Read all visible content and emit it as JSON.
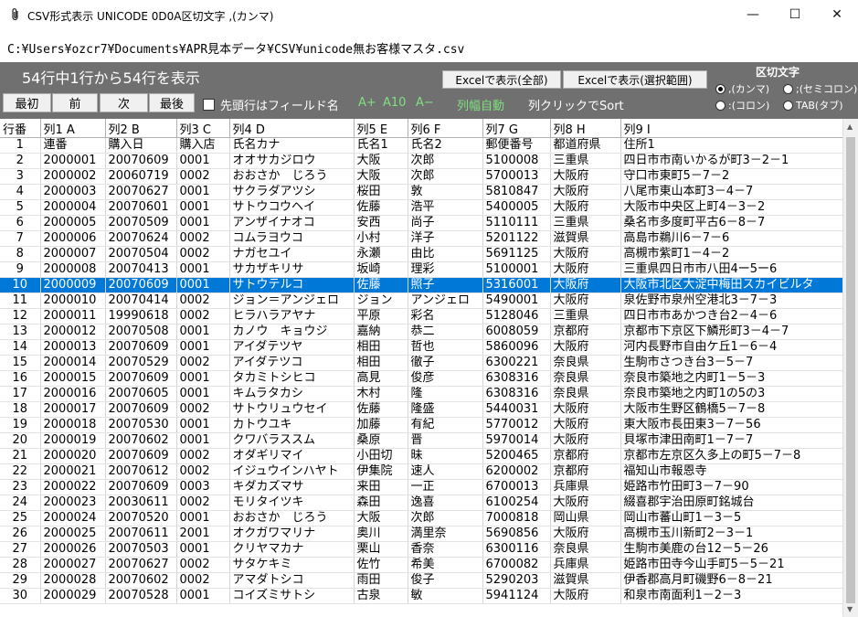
{
  "window": {
    "title": "CSV形式表示 UNICODE 0D0A区切文字 ,(カンマ)",
    "minimize": "—",
    "maximize": "☐",
    "close": "✕"
  },
  "path": "C:¥Users¥ozcr7¥Documents¥APR見本データ¥CSV¥unicode無お客様マスタ.csv",
  "toolbar": {
    "status": "54行中1行から54行を表示",
    "first": "最初",
    "prev": "前",
    "next": "次",
    "last": "最後",
    "header_checkbox_label": "先頭行はフィールド名",
    "font_up": "A+",
    "font_size": "A10",
    "font_down": "A−",
    "auto_width": "列幅自動",
    "sort_hint": "列クリックでSort",
    "excel_all": "Excelで表示(全部)",
    "excel_selected": "Excelで表示(選択範囲)"
  },
  "delimiter": {
    "title": "区切文字",
    "comma": ",(カンマ)",
    "semicolon": ";(セミコロン)",
    "colon": ":(コロン)",
    "tab": "TAB(タブ)",
    "selected": "comma"
  },
  "colors": {
    "toolbar_bg": "#707070",
    "selection": "#0078d7",
    "link_green": "#7fe07f"
  },
  "grid": {
    "columns": [
      "行番",
      "列1 A",
      "列2 B",
      "列3 C",
      "列4 D",
      "列5 E",
      "列6 F",
      "列7 G",
      "列8 H",
      "列9 I"
    ],
    "selected_row": 10,
    "rows": [
      [
        "1",
        "連番",
        "購入日",
        "購入店",
        "氏名カナ",
        "氏名1",
        "氏名2",
        "郵便番号",
        "都道府県",
        "住所1"
      ],
      [
        "2",
        "2000001",
        "20070609",
        "0001",
        "オオサカジロウ",
        "大阪",
        "次郎",
        "5100008",
        "三重県",
        "四日市市南いかるが町3－2－1"
      ],
      [
        "3",
        "2000002",
        "20060719",
        "0002",
        "おおさか　じろう",
        "大阪",
        "次郎",
        "5700013",
        "大阪府",
        "守口市東町5－7－2"
      ],
      [
        "4",
        "2000003",
        "20070627",
        "0001",
        "サクラダアツシ",
        "桜田",
        "敦",
        "5810847",
        "大阪府",
        "八尾市東山本町3－4－7"
      ],
      [
        "5",
        "2000004",
        "20070601",
        "0001",
        "サトウコウヘイ",
        "佐藤",
        "浩平",
        "5400005",
        "大阪府",
        "大阪市中央区上町4－3－2"
      ],
      [
        "6",
        "2000005",
        "20070509",
        "0001",
        "アンザイナオコ",
        "安西",
        "尚子",
        "5110111",
        "三重県",
        "桑名市多度町平古6－8－7"
      ],
      [
        "7",
        "2000006",
        "20070624",
        "0002",
        "コムラヨウコ",
        "小村",
        "洋子",
        "5201122",
        "滋賀県",
        "高島市鵜川6－7－6"
      ],
      [
        "8",
        "2000007",
        "20070504",
        "0002",
        "ナガセユイ",
        "永瀬",
        "由比",
        "5691125",
        "大阪府",
        "高槻市紫町1－4－2"
      ],
      [
        "9",
        "2000008",
        "20070413",
        "0001",
        "サカザキリサ",
        "坂崎",
        "理彩",
        "5100001",
        "大阪府",
        "三重県四日市市八田4ー5ー6"
      ],
      [
        "10",
        "2000009",
        "20070609",
        "0001",
        "サトウテルコ",
        "佐藤",
        "照子",
        "5316001",
        "大阪府",
        "大阪市北区大淀中梅田スカイビルタ"
      ],
      [
        "11",
        "2000010",
        "20070414",
        "0002",
        "ジョン＝アンジェロ",
        "ジョン",
        "アンジェロ",
        "5490001",
        "大阪府",
        "泉佐野市泉州空港北3－7－3"
      ],
      [
        "12",
        "2000011",
        "19990618",
        "0002",
        "ヒラハラアヤナ",
        "平原",
        "彩名",
        "5128046",
        "三重県",
        "四日市市あかつき台2－4－6"
      ],
      [
        "13",
        "2000012",
        "20070508",
        "0001",
        "カノウ　キョウジ",
        "嘉納",
        "恭二",
        "6008059",
        "京都府",
        "京都市下京区下鱗形町3－4－7"
      ],
      [
        "14",
        "2000013",
        "20070609",
        "0001",
        "アイダテツヤ",
        "相田",
        "哲也",
        "5860096",
        "大阪府",
        "河内長野市自由ケ丘1－6－4"
      ],
      [
        "15",
        "2000014",
        "20070529",
        "0002",
        "アイダテツコ",
        "相田",
        "徹子",
        "6300221",
        "奈良県",
        "生駒市さつき台3－5－7"
      ],
      [
        "16",
        "2000015",
        "20070609",
        "0001",
        "タカミトシヒコ",
        "高見",
        "俊彦",
        "6308316",
        "奈良県",
        "奈良市築地之内町1－5－3"
      ],
      [
        "17",
        "2000016",
        "20070605",
        "0001",
        "キムラタカシ",
        "木村",
        "隆",
        "6308316",
        "奈良県",
        "奈良市築地之内町1の5の3"
      ],
      [
        "18",
        "2000017",
        "20070609",
        "0002",
        "サトウリュウセイ",
        "佐藤",
        "隆盛",
        "5440031",
        "大阪府",
        "大阪市生野区鶴橋5－7－8"
      ],
      [
        "19",
        "2000018",
        "20070530",
        "0001",
        "カトウユキ",
        "加藤",
        "有紀",
        "5770012",
        "大阪府",
        "東大阪市長田東3－7－56"
      ],
      [
        "20",
        "2000019",
        "20070602",
        "0001",
        "クワバラススム",
        "桑原",
        "晋",
        "5970014",
        "大阪府",
        "貝塚市津田南町1－7－7"
      ],
      [
        "21",
        "2000020",
        "20070609",
        "0002",
        "オダギリマイ",
        "小田切",
        "昧",
        "5200465",
        "京都府",
        "京都市左京区久多上の町5－7－8"
      ],
      [
        "22",
        "2000021",
        "20070612",
        "0002",
        "イジュウインハヤト",
        "伊集院",
        "速人",
        "6200002",
        "京都府",
        "福知山市報恩寺"
      ],
      [
        "23",
        "2000022",
        "20070609",
        "0003",
        "キダカズマサ",
        "来田",
        "一正",
        "6700013",
        "兵庫県",
        "姫路市竹田町3－7－90"
      ],
      [
        "24",
        "2000023",
        "20030611",
        "0002",
        "モリタイツキ",
        "森田",
        "逸喜",
        "6100254",
        "大阪府",
        "綴喜郡宇治田原町銘城台"
      ],
      [
        "25",
        "2000024",
        "20070520",
        "0001",
        "おおさか　じろう",
        "大阪",
        "次郎",
        "7000818",
        "岡山県",
        "岡山市蕃山町1－3－5"
      ],
      [
        "26",
        "2000025",
        "20070611",
        "2001",
        "オクガワマリナ",
        "奥川",
        "満里奈",
        "5690856",
        "大阪府",
        "高槻市玉川新町2－3－1"
      ],
      [
        "27",
        "2000026",
        "20070503",
        "0001",
        "クリヤマカナ",
        "栗山",
        "香奈",
        "6300116",
        "奈良県",
        "生駒市美鹿の台12－5－26"
      ],
      [
        "28",
        "2000027",
        "20070627",
        "0002",
        "サタケキミ",
        "佐竹",
        "希美",
        "6700082",
        "兵庫県",
        "姫路市田寺今山手町5－5－21"
      ],
      [
        "29",
        "2000028",
        "20070602",
        "0002",
        "アマダトシコ",
        "雨田",
        "俊子",
        "5290203",
        "滋賀県",
        "伊香郡高月町磯野6－8－21"
      ],
      [
        "30",
        "2000029",
        "20070528",
        "0001",
        "コイズミサトシ",
        "古泉",
        "敏",
        "5941124",
        "大阪府",
        "和泉市南面利1－2－3"
      ]
    ]
  }
}
